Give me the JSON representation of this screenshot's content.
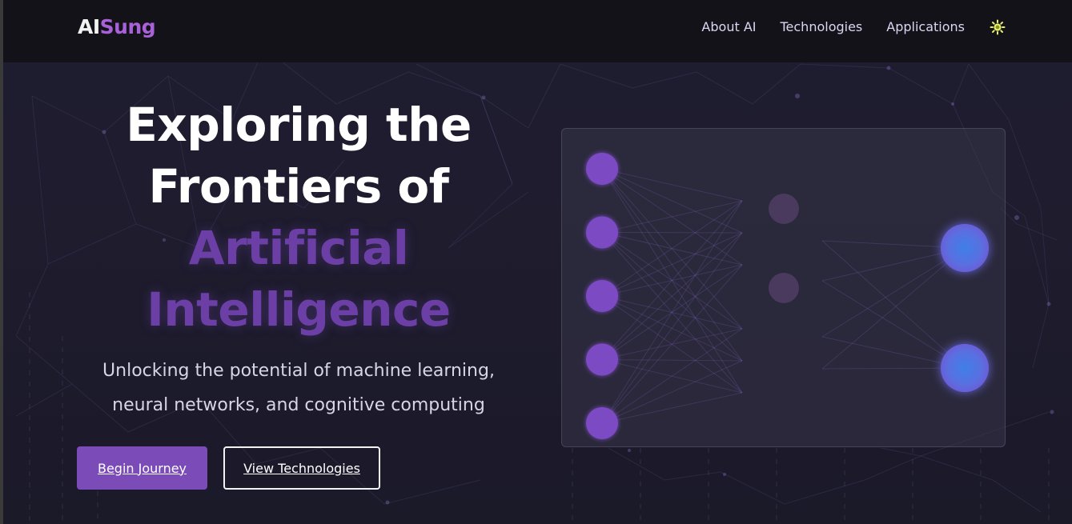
{
  "brand": {
    "logo_ai": "AI",
    "logo_sung": "Sung",
    "accent": "#a861d8"
  },
  "nav": {
    "links": [
      "About AI",
      "Technologies",
      "Applications"
    ],
    "theme_icon": "sun-icon"
  },
  "hero": {
    "title_line1": "Exploring the",
    "title_line2": "Frontiers of",
    "title_line3": "Artificial",
    "title_line4": "Intelligence",
    "subtitle_line1": "Unlocking the potential of machine learning,",
    "subtitle_line2": "neural networks, and cognitive computing",
    "primary_button": "Begin Journey",
    "secondary_button": "View Technologies"
  },
  "network": {
    "input_nodes": 5,
    "hidden_nodes": 2,
    "output_nodes": 2,
    "input_color": "#7b4bc4",
    "hidden_color": "#4a3a5e",
    "output_color": "#3f7fe8"
  }
}
